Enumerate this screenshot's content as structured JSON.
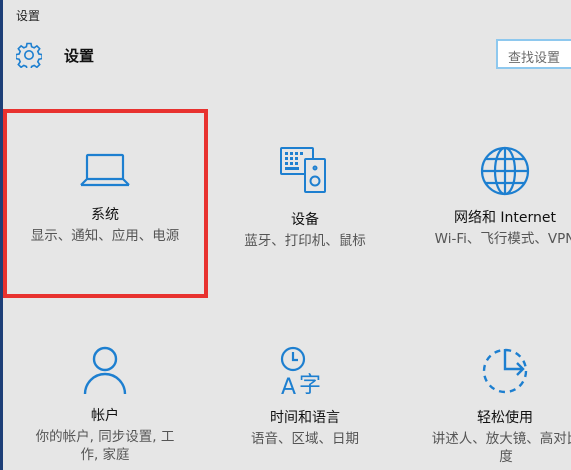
{
  "window": {
    "title": "设置"
  },
  "header": {
    "title": "设置",
    "icon": "gear-icon"
  },
  "search": {
    "placeholder": "查找设置"
  },
  "accent_color": "#1d7fd0",
  "highlight_color": "#e8322f",
  "tiles": [
    {
      "name": "系统",
      "desc": "显示、通知、应用、电源",
      "icon": "laptop-icon"
    },
    {
      "name": "设备",
      "desc": "蓝牙、打印机、鼠标",
      "icon": "devices-icon"
    },
    {
      "name": "网络和 Internet",
      "desc": "Wi-Fi、飞行模式、VPN",
      "icon": "globe-icon"
    },
    {
      "name": "帐户",
      "desc": "你的帐户, 同步设置, 工作, 家庭",
      "icon": "person-icon"
    },
    {
      "name": "时间和语言",
      "desc": "语音、区域、日期",
      "icon": "time-language-icon"
    },
    {
      "name": "轻松使用",
      "desc": "讲述人、放大镜、高对比度",
      "icon": "ease-of-access-icon"
    }
  ]
}
